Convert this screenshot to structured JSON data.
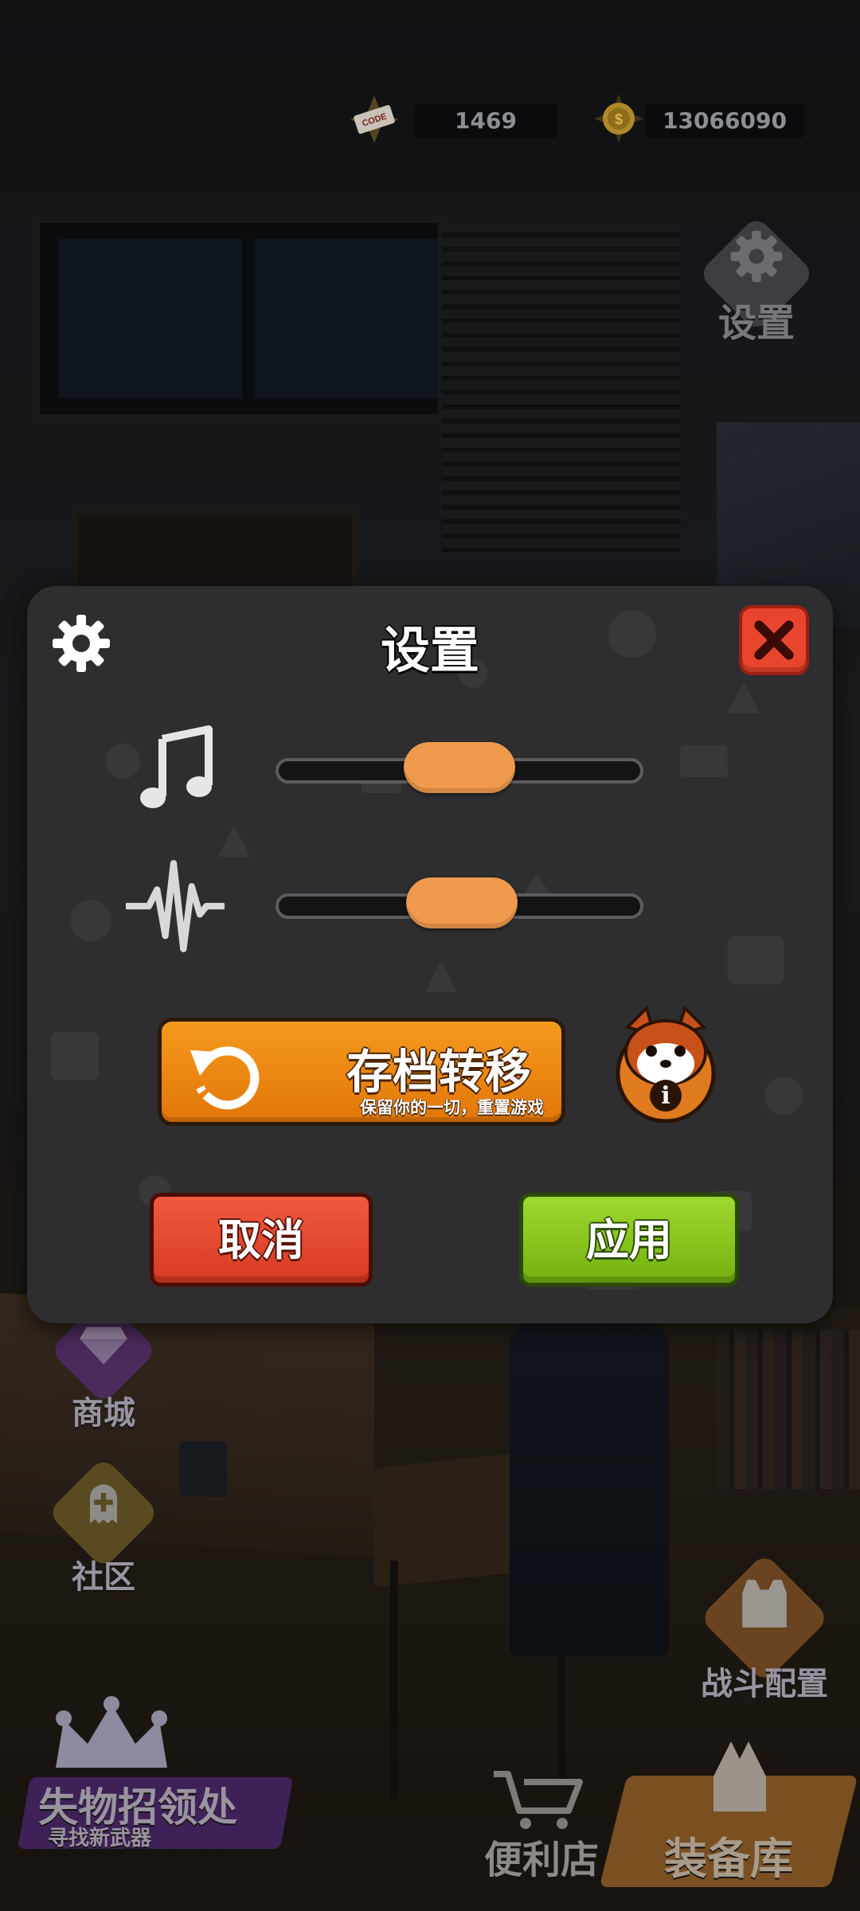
{
  "hud": {
    "code_count": "1469",
    "coin_count": "13066090",
    "settings_label": "设置"
  },
  "side_nav": {
    "shop_label": "商城",
    "community_label": "社区",
    "lost_found_label": "失物招领处",
    "lost_found_sub": "寻找新武器",
    "store_label": "便利店",
    "loadout_label": "战斗配置",
    "armory_label": "装备库"
  },
  "settings_modal": {
    "title": "设置",
    "music_volume": 0.5,
    "sfx_volume": 0.51,
    "transfer_title": "存档转移",
    "transfer_subtitle": "保留你的一切，重置游戏",
    "cancel_label": "取消",
    "apply_label": "应用"
  },
  "colors": {
    "accent_orange": "#f28a12",
    "cancel_red": "#e5472d",
    "apply_green": "#8ccb22",
    "close_red": "#e9452e",
    "knob": "#ef9a4c"
  },
  "icons": [
    "code-ticket-icon",
    "coin-icon",
    "gear-icon",
    "close-icon",
    "music-note-icon",
    "waveform-icon",
    "undo-icon",
    "red-panda-info-icon",
    "diamond-icon",
    "community-plus-icon",
    "crown-icon",
    "cart-icon",
    "vest-icon",
    "armory-icon"
  ]
}
